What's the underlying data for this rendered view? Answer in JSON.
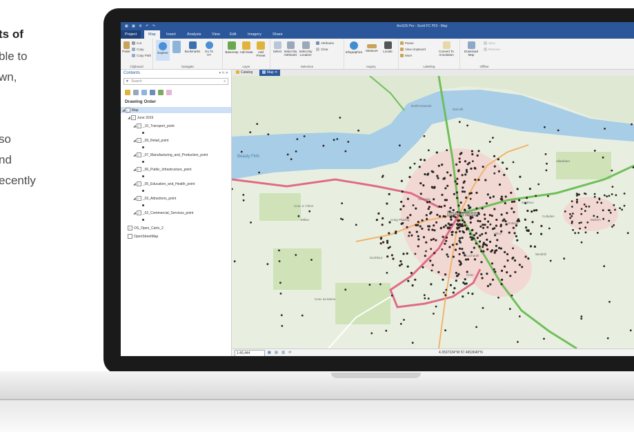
{
  "left_text": {
    "line1": "ts of",
    "line2": "ble to",
    "line3": "wn,",
    "line4": "so",
    "line5": "nd",
    "line6": "ecently"
  },
  "app": {
    "title": "ArcGIS Pro - Scott FC POI - Map",
    "tabs": [
      "Project",
      "Map",
      "Insert",
      "Analysis",
      "View",
      "Edit",
      "Imagery",
      "Share"
    ],
    "active_tab": "Map"
  },
  "ribbon": {
    "clipboard": {
      "label": "Clipboard",
      "paste": "Paste",
      "cut": "Cut",
      "copy": "Copy",
      "copy_path": "Copy Path"
    },
    "navigate": {
      "label": "Navigate",
      "explore": "Explore",
      "bookmarks": "Bookmarks",
      "goto": "Go To XY"
    },
    "layer": {
      "label": "Layer",
      "basemap": "Basemap",
      "add_data": "Add Data",
      "add_preset": "Add Preset"
    },
    "selection": {
      "label": "Selection",
      "select": "Select",
      "select_by_attributes": "Select By Attributes",
      "select_by_location": "Select By Location",
      "attributes": "Attributes",
      "clear": "Clear"
    },
    "inquiry": {
      "label": "Inquiry",
      "infographics": "Infographics",
      "measure": "Measure",
      "locate": "Locate"
    },
    "labeling": {
      "label": "Labeling",
      "pause": "Pause",
      "view_unplaced": "View Unplaced",
      "more": "More",
      "convert": "Convert To Annotation"
    },
    "offline": {
      "label": "Offline",
      "download_map": "Download Map",
      "sync": "Sync",
      "remove": "Remove"
    }
  },
  "contents": {
    "title": "Contents",
    "search_placeholder": "Search",
    "drawing_order": "Drawing Order",
    "map": "Map",
    "group": "June 2019",
    "layers": [
      "_10_Transport_point",
      "_09_Retail_point",
      "_07_Manufacturing_and_Production_point",
      "_06_Public_Infrastructure_point",
      "_05_Education_and_Health_point",
      "_03_Attractions_point",
      "_02_Commercial_Services_point"
    ],
    "basemaps": [
      "OS_Open_Carto_2",
      "OpenStreetMap"
    ]
  },
  "view_tabs": {
    "catalog": "Catalog",
    "map": "Map"
  },
  "map_labels": {
    "firth": "Beauly Firth",
    "city": "Inverness",
    "lochardil": "Lochardil",
    "balloch": "Balloch",
    "culloden": "Culloden",
    "smithton": "Smithton",
    "westhill": "Westhill",
    "hilton": "Hilton",
    "drakies": "Drakies",
    "scorguie": "Scorguie",
    "holm": "Holm",
    "dochfour": "Dochfour",
    "cnoc_an_t_sidhein": "Cnoc na Moine",
    "cnoc_a_chinn": "Cnoc a' Chinn",
    "milton": "Milton",
    "kessock": "North Kessock",
    "craig_phadrig": "Craig Phadrig",
    "ord_hill": "Ord Hill",
    "allanfearn": "Allanfearn"
  },
  "status": {
    "scale": "1:45,444",
    "coords": "4.3537334°W 57.4653640°N"
  }
}
